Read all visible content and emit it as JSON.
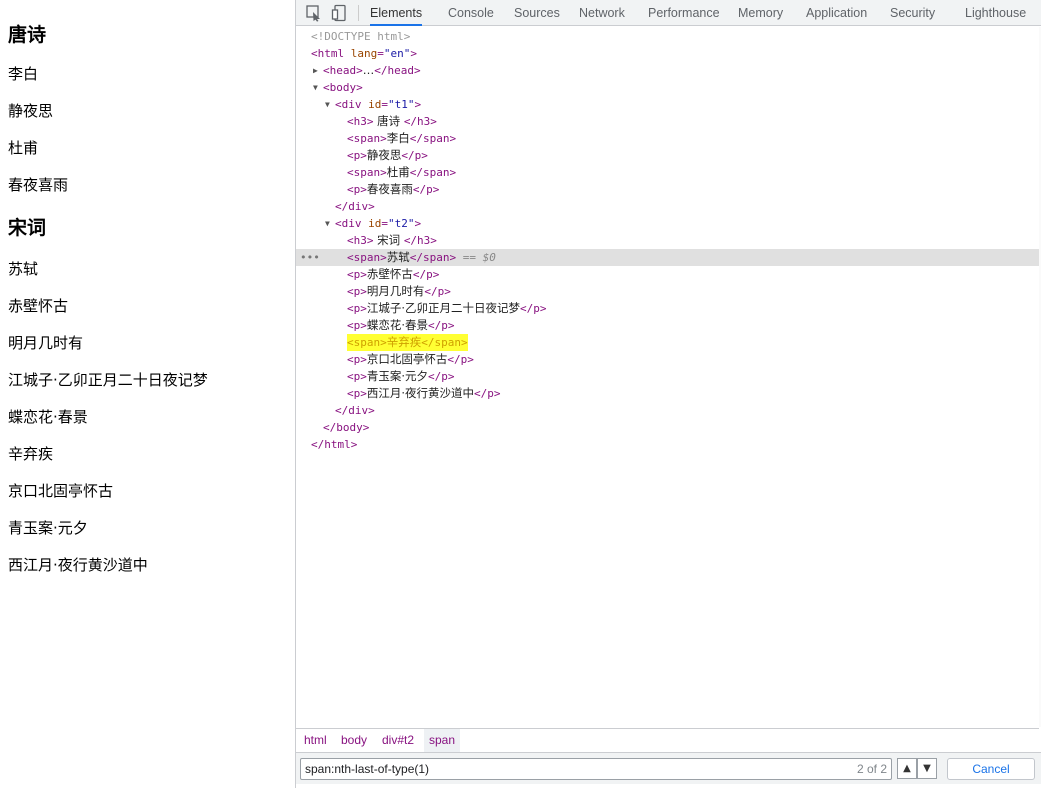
{
  "page": {
    "h3_tang": "唐诗",
    "tang_lines": [
      "李白",
      "静夜思",
      "杜甫",
      "春夜喜雨"
    ],
    "h3_song": "宋词",
    "song_lines": [
      "苏轼",
      "赤壁怀古",
      "明月几时有",
      "江城子·乙卯正月二十日夜记梦",
      "蝶恋花·春景",
      "辛弃疾",
      "京口北固亭怀古",
      "青玉案·元夕",
      "西江月·夜行黄沙道中"
    ]
  },
  "devtools": {
    "tabs": [
      "Elements",
      "Console",
      "Sources",
      "Network",
      "Performance",
      "Memory",
      "Application",
      "Security",
      "Lighthouse"
    ],
    "active_tab": "Elements",
    "tree": {
      "doctype": "<!DOCTYPE html>",
      "html_open": "<html",
      "html_attr_name": "lang",
      "html_attr_value": "\"en\"",
      "head": "<head>",
      "head_ellipsis": "…",
      "head_close": "</head>",
      "body_open": "<body>",
      "div_open": "<div",
      "id_attr": "id",
      "t1_value": "\"t1\"",
      "t2_value": "\"t2\"",
      "h3_open": "<h3>",
      "h3_close": "</h3>",
      "span_open": "<span>",
      "span_close": "</span>",
      "p_open": "<p>",
      "p_close": "</p>",
      "div_close": "</div>",
      "body_close": "</body>",
      "html_close": "</html>",
      "t1_h3_text": " 唐诗 ",
      "t2_h3_text": " 宋词 ",
      "selected_marker": " == $0",
      "gt": ">"
    },
    "breadcrumbs": [
      "html",
      "body",
      "div#t2",
      "span"
    ],
    "search": {
      "value": "span:nth-last-of-type(1)",
      "match_count": "2 of 2",
      "cancel_label": "Cancel"
    }
  }
}
